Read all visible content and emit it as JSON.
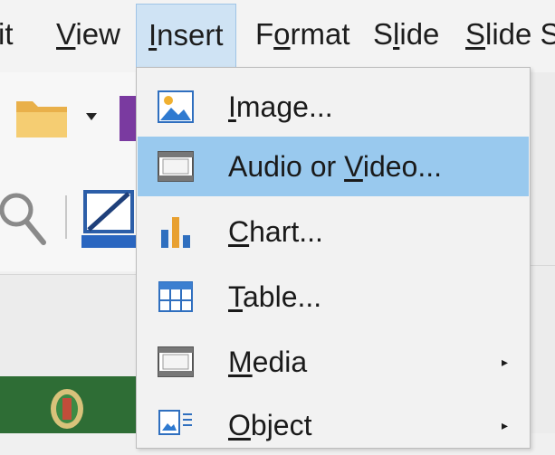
{
  "menubar": {
    "items": [
      {
        "pre": "",
        "u": "",
        "post": "it"
      },
      {
        "pre": "",
        "u": "V",
        "post": "iew"
      },
      {
        "pre": "",
        "u": "I",
        "post": "nsert"
      },
      {
        "pre": "F",
        "u": "o",
        "post": "rmat"
      },
      {
        "pre": "S",
        "u": "l",
        "post": "ide"
      },
      {
        "pre": "",
        "u": "S",
        "post": "lide Sh"
      }
    ]
  },
  "insert_menu": {
    "items": [
      {
        "pre": "",
        "u": "I",
        "post": "mage...",
        "icon": "image-icon",
        "submenu": false,
        "highlighted": false
      },
      {
        "pre": "Audio or ",
        "u": "V",
        "post": "ideo...",
        "icon": "film-icon",
        "submenu": false,
        "highlighted": true
      },
      {
        "pre": "",
        "u": "C",
        "post": "hart...",
        "icon": "bar-chart-icon",
        "submenu": false,
        "highlighted": false
      },
      {
        "pre": "",
        "u": "T",
        "post": "able...",
        "icon": "table-icon",
        "submenu": false,
        "highlighted": false
      },
      {
        "pre": "",
        "u": "M",
        "post": "edia",
        "icon": "media-icon",
        "submenu": true,
        "highlighted": false
      },
      {
        "pre": "",
        "u": "O",
        "post": "bject",
        "icon": "object-icon",
        "submenu": true,
        "highlighted": false
      }
    ],
    "submenu_arrow": "▸"
  },
  "colors": {
    "highlight": "#99c9ee",
    "active_menu": "#cfe3f4",
    "green_panel": "#2e6d35",
    "folder": "#f0c060",
    "chart_blue": "#3a7bc8",
    "chart_orange": "#e8a030"
  }
}
